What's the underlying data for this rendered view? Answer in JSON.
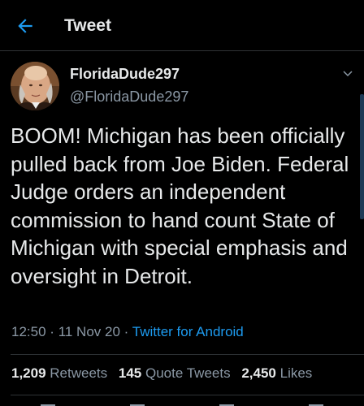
{
  "header": {
    "title": "Tweet",
    "back_icon": "back-arrow-icon"
  },
  "colors": {
    "background": "#000000",
    "accent": "#1d9bf0",
    "text": "#e7e9ea",
    "muted": "#8b98a5",
    "divider": "#2f3336"
  },
  "author": {
    "display_name": "FloridaDude297",
    "handle": "@FloridaDude297"
  },
  "tweet": {
    "text": "BOOM! Michigan has been officially pulled back from Joe Biden. Federal Judge orders an independent commission to hand count State of Michigan with special emphasis and oversight in Detroit.",
    "time": "12:50",
    "separator": "·",
    "date": "11 Nov 20",
    "source": "Twitter for Android"
  },
  "stats": {
    "retweets_count": "1,209",
    "retweets_label": "Retweets",
    "quotes_count": "145",
    "quotes_label": "Quote Tweets",
    "likes_count": "2,450",
    "likes_label": "Likes"
  }
}
